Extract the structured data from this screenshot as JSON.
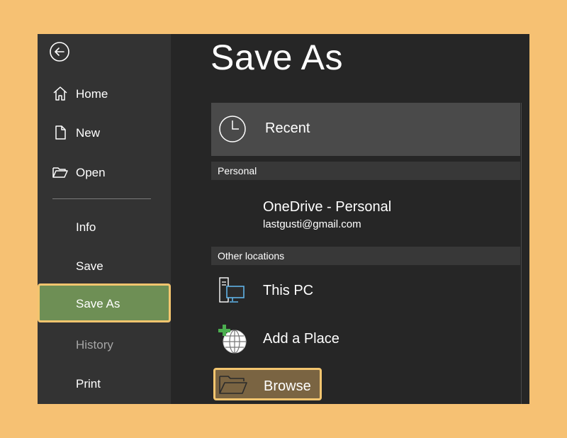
{
  "sidebar": {
    "items": [
      {
        "label": "Home",
        "icon": "home-icon"
      },
      {
        "label": "New",
        "icon": "new-document-icon"
      },
      {
        "label": "Open",
        "icon": "folder-open-icon"
      },
      {
        "label": "Info"
      },
      {
        "label": "Save"
      },
      {
        "label": "Save As",
        "active": true
      },
      {
        "label": "History",
        "disabled": true
      },
      {
        "label": "Print"
      }
    ]
  },
  "main": {
    "title": "Save As",
    "recent_label": "Recent",
    "personal_header": "Personal",
    "onedrive": {
      "name": "OneDrive - Personal",
      "account": "lastgusti@gmail.com"
    },
    "other_header": "Other locations",
    "locations": [
      {
        "label": "This PC",
        "icon": "computer-icon"
      },
      {
        "label": "Add a Place",
        "icon": "add-place-globe-icon"
      },
      {
        "label": "Browse",
        "icon": "browse-folder-icon",
        "highlighted": true
      }
    ]
  },
  "colors": {
    "background": "#f6c173",
    "sidebar": "#333333",
    "main": "#262626",
    "active_item": "#6e8f55",
    "highlight_border": "#f3c56f",
    "browse_fill": "#7a6442"
  }
}
